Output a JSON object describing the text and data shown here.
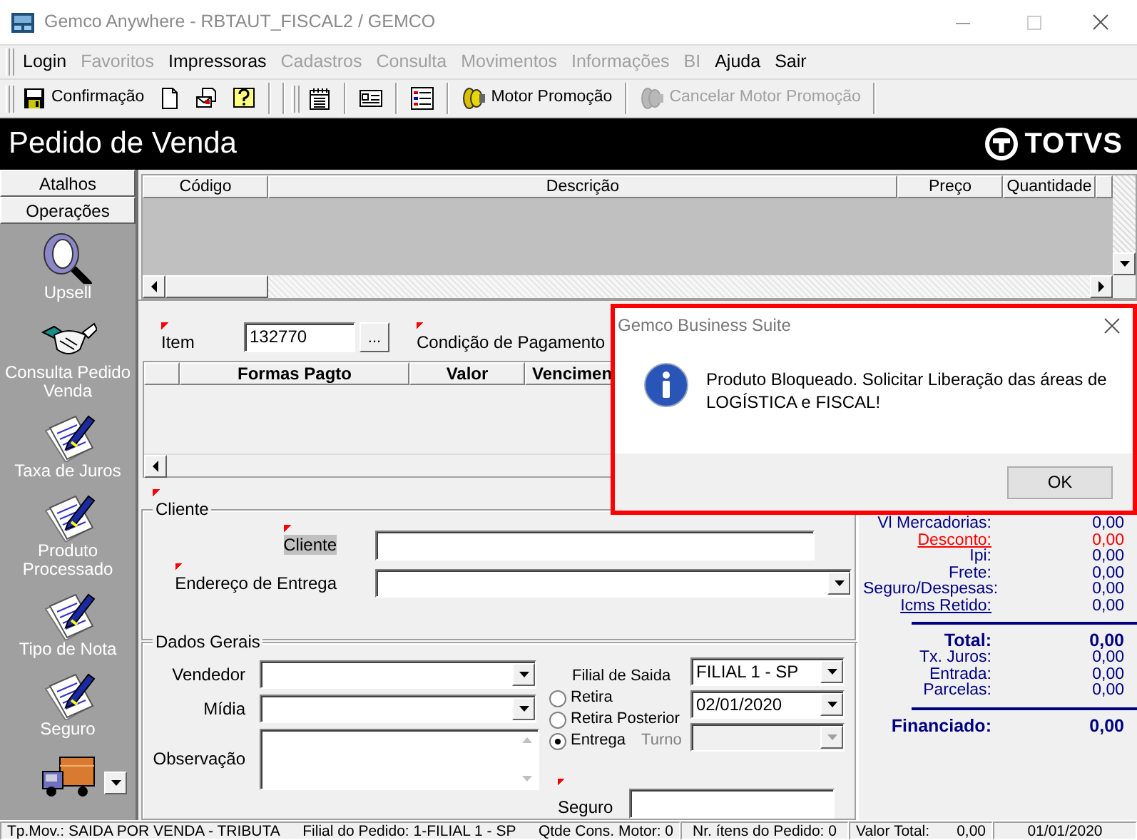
{
  "window": {
    "title": "Gemco Anywhere - RBTAUT_FISCAL2 / GEMCO"
  },
  "menu": [
    {
      "label": "Login",
      "disabled": false
    },
    {
      "label": "Favoritos",
      "disabled": true
    },
    {
      "label": "Impressoras",
      "disabled": false
    },
    {
      "label": "Cadastros",
      "disabled": true
    },
    {
      "label": "Consulta",
      "disabled": true
    },
    {
      "label": "Movimentos",
      "disabled": true
    },
    {
      "label": "Informações",
      "disabled": true
    },
    {
      "label": "BI",
      "disabled": true
    },
    {
      "label": "Ajuda",
      "disabled": false
    },
    {
      "label": "Sair",
      "disabled": false
    }
  ],
  "toolbar": [
    {
      "kind": "save",
      "label": "Confirmação",
      "disabled": false
    },
    {
      "kind": "new"
    },
    {
      "kind": "envelope"
    },
    {
      "kind": "help"
    },
    {
      "kind": "separator"
    },
    {
      "kind": "calendar"
    },
    {
      "kind": "card"
    },
    {
      "kind": "list"
    },
    {
      "kind": "motor",
      "label": "Motor Promoção",
      "disabled": false
    },
    {
      "kind": "motor",
      "label": "Cancelar Motor Promoção",
      "disabled": true
    }
  ],
  "header": {
    "title": "Pedido de Venda",
    "logo": "TOTVS"
  },
  "sidebar": {
    "tabs": [
      "Atalhos",
      "Operações"
    ],
    "items": [
      {
        "kind": "magnifier",
        "label": "Upsell"
      },
      {
        "kind": "handshake",
        "label": "Consulta Pedido Venda"
      },
      {
        "kind": "form",
        "label": "Taxa de Juros"
      },
      {
        "kind": "form",
        "label": "Produto Processado"
      },
      {
        "kind": "form",
        "label": "Tipo de Nota"
      },
      {
        "kind": "form",
        "label": "Seguro"
      },
      {
        "kind": "truck"
      }
    ]
  },
  "products": {
    "columns": [
      "Código",
      "Descrição",
      "Preço",
      "Quantidade"
    ]
  },
  "item_form": {
    "item": {
      "label": "Item",
      "value": "132770",
      "required": true
    },
    "lookup": "...",
    "payment_condition": {
      "label": "Condição de Pagamento",
      "required": true
    },
    "payments": {
      "columns": [
        "Formas Pagto",
        "Valor",
        "Vencimen"
      ]
    }
  },
  "cliente": {
    "title": "Cliente",
    "required": true,
    "fields": [
      {
        "kind": "text",
        "label": "Cliente",
        "required": true,
        "focused": true
      },
      {
        "kind": "select",
        "label": "Endereço de Entrega",
        "required": true,
        "focused": false
      }
    ]
  },
  "dados_gerais": {
    "title": "Dados Gerais",
    "fields": [
      {
        "kind": "select",
        "label": "Vendedor"
      },
      {
        "kind": "select",
        "label": "Mídia"
      },
      {
        "kind": "textarea",
        "label": "Observação"
      }
    ],
    "filial": {
      "label": "Filial de Saida",
      "value": "FILIAL 1 - SP"
    },
    "delivery": [
      {
        "label": "Retira",
        "selected": false
      },
      {
        "label": "Retira Posterior",
        "selected": false
      },
      {
        "label": "Entrega",
        "selected": true
      }
    ],
    "date": {
      "value": "02/01/2020"
    },
    "turno": {
      "label": "Turno",
      "disabled": true
    },
    "seguro": {
      "label": "Seguro",
      "required": true
    }
  },
  "totals": [
    {
      "kind": "plain",
      "label": "Vl Mercadorias:",
      "value": "0,00"
    },
    {
      "kind": "alert-link",
      "label": "Desconto:",
      "value": "0,00"
    },
    {
      "kind": "plain",
      "label": "Ipi:",
      "value": "0,00"
    },
    {
      "kind": "plain",
      "label": "Frete:",
      "value": "0,00"
    },
    {
      "kind": "plain",
      "label": "Seguro/Despesas:",
      "value": "0,00"
    },
    {
      "kind": "link",
      "label": "Icms Retido:",
      "value": "0,00"
    },
    {
      "kind": "rule"
    },
    {
      "kind": "total",
      "label": "Total:",
      "value": "0,00"
    },
    {
      "kind": "plain",
      "label": "Tx. Juros:",
      "value": "0,00"
    },
    {
      "kind": "plain",
      "label": "Entrada:",
      "value": "0,00"
    },
    {
      "kind": "plain",
      "label": "Parcelas:",
      "value": "0,00"
    },
    {
      "kind": "rule"
    },
    {
      "kind": "total",
      "label": "Financiado:",
      "value": "0,00"
    }
  ],
  "status_bar": [
    {
      "items": [
        "Tp.Mov.: SAIDA POR VENDA - TRIBUTA",
        "Filial do Pedido: 1-FILIAL 1 - SP",
        "Qtde Cons. Motor: 0"
      ]
    },
    {
      "items": [
        "Nr. ítens do Pedido: 0"
      ]
    },
    {
      "items": [
        "Valor Total:",
        "0,00"
      ]
    },
    {
      "items": [
        "01/01/2020"
      ]
    }
  ],
  "dialog": {
    "title": "Gemco Business Suite",
    "message": "Produto Bloqueado. Solicitar Liberação das áreas de LOGÍSTICA e FISCAL!",
    "button": "OK"
  }
}
